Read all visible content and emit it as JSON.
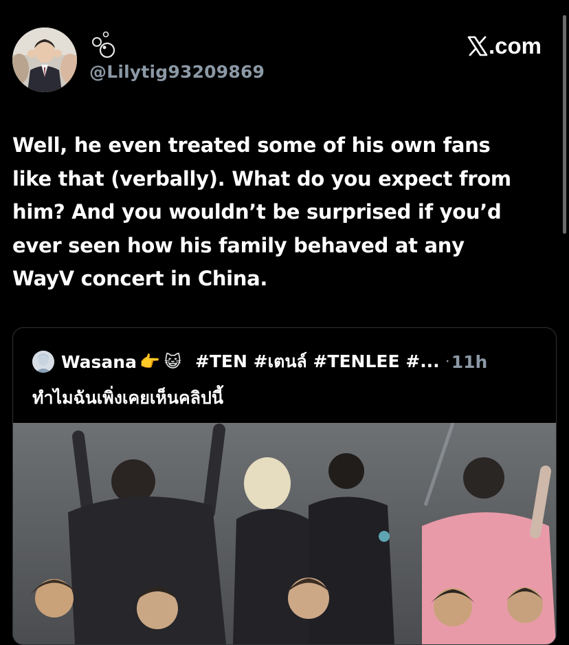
{
  "author": {
    "display_name_icon": "bubbles-icon",
    "handle": "@Lilytig93209869"
  },
  "brand": {
    "label": ".com",
    "logo": "x-logo-icon"
  },
  "tweet": {
    "lines": [
      "Well, he even treated some of his own fans",
      "like that (verbally). What do you expect from",
      "him? And you wouldn’t be surprised if you’d",
      "ever seen how his family behaved at any",
      "WayV concert in China."
    ]
  },
  "quoted_tweet": {
    "name": "Wasana",
    "emoji_1": "👉",
    "emoji_2": "😺",
    "tags": "#TEN #เตนล์ #TENLEE #...",
    "dot": "·",
    "time": "11h",
    "text": "ทำไมฉันเพิ่งเคยเห็นคลิปนี้",
    "media_type": "video-thumbnail"
  },
  "colors": {
    "background": "#000000",
    "text": "#ffffff",
    "muted": "#8b98a5",
    "border": "#2f3336"
  }
}
